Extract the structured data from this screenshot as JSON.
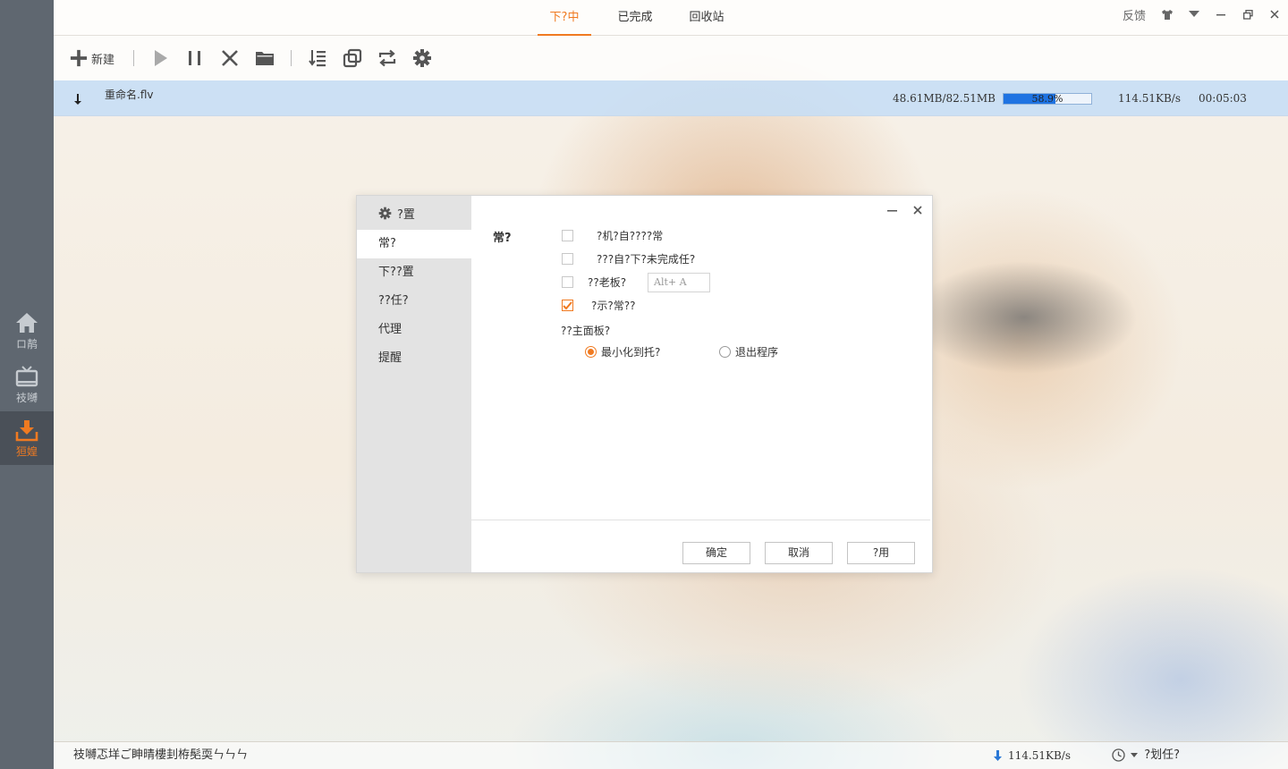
{
  "sidebar": {
    "items": [
      {
        "label": "ロ䴖",
        "icon": "home-icon"
      },
      {
        "label": "衼嚩",
        "icon": "tv-icon"
      },
      {
        "label": "狟媓",
        "icon": "download-icon"
      }
    ],
    "active_color": "#f07a21"
  },
  "tabs": [
    {
      "label": "下?中"
    },
    {
      "label": "已完成"
    },
    {
      "label": "回收站"
    }
  ],
  "window": {
    "feedback_label": "反馈"
  },
  "toolbar": {
    "new_label": "新建"
  },
  "task": {
    "name": "重命名.flv",
    "size": "48.61MB/82.51MB",
    "progress_text": "58.9%",
    "progress_value": 58.9,
    "speed": "114.51KB/s",
    "time_left": "00:05:03"
  },
  "statusbar": {
    "message": "衼嚩忑垟ご眒晴樓刲栫髧耎ㄣㄣㄣ",
    "speed": "114.51KB/s",
    "plan_label": "?划任?"
  },
  "dialog": {
    "title": "?置",
    "nav": [
      {
        "label": "常?"
      },
      {
        "label": "下??置"
      },
      {
        "label": "??任?"
      },
      {
        "label": "代理"
      },
      {
        "label": "提醒"
      }
    ],
    "section_label": "常?",
    "options": [
      {
        "label": "?机?自????常",
        "checked": false
      },
      {
        "label": "???自?下?未完成任?",
        "checked": false
      },
      {
        "label": "??老板?",
        "checked": false
      },
      {
        "label": "?示?常??",
        "checked": true
      }
    ],
    "hotkey_value": "Alt+ A",
    "close_panel_label": "??主面板?",
    "radios": [
      {
        "label": "最小化到托?",
        "selected": true
      },
      {
        "label": "退出程序",
        "selected": false
      }
    ],
    "buttons": {
      "ok": "确定",
      "cancel": "取消",
      "apply": "?用"
    }
  }
}
